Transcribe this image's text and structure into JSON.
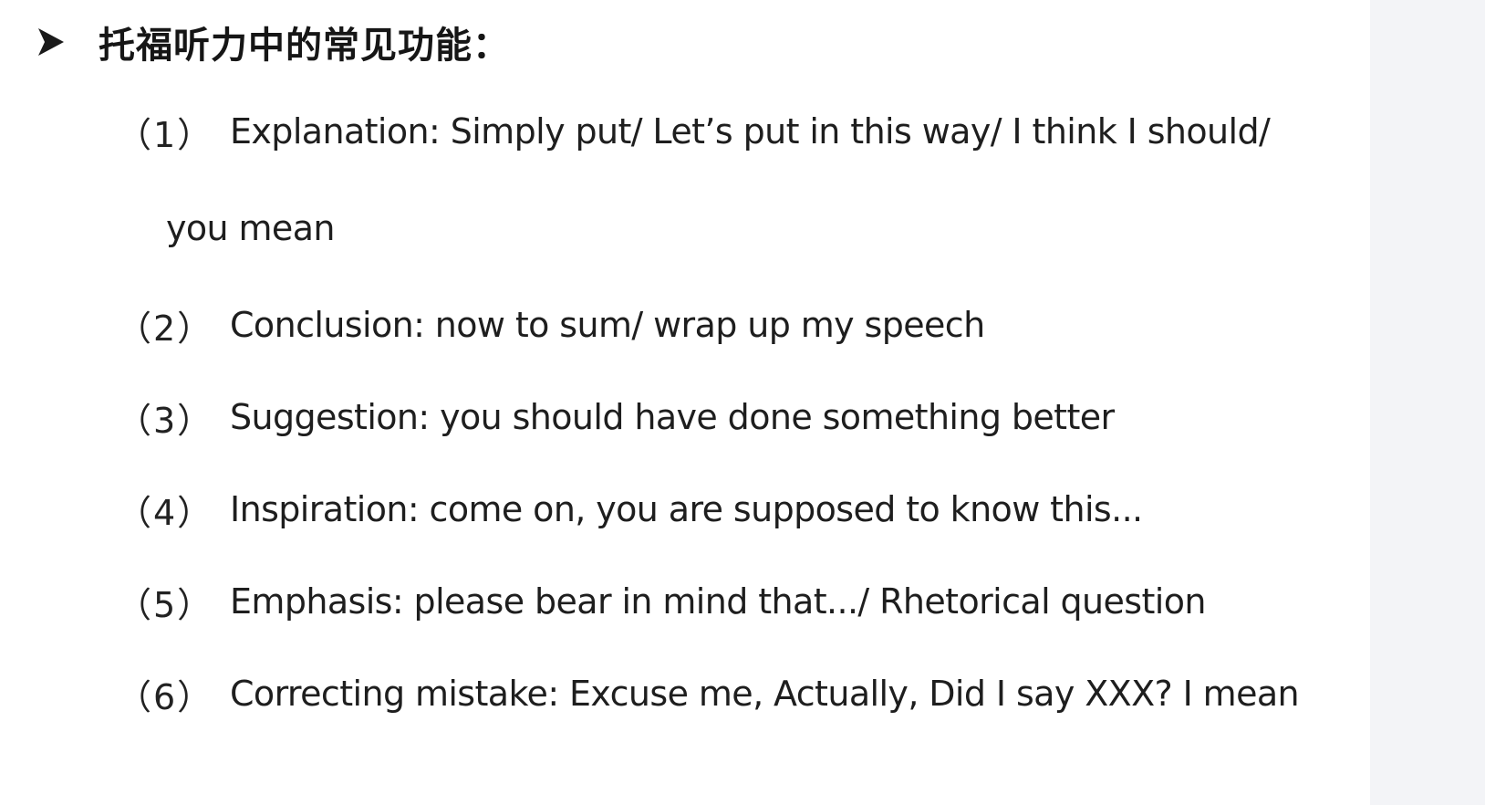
{
  "heading": {
    "bullet_icon": "arrowhead-bullet-icon",
    "text": "托福听力中的常见功能："
  },
  "items": [
    {
      "number": "（1）",
      "text": "Explanation: Simply put/ Let’s put in this way/ I think I should/",
      "continuation": "you mean"
    },
    {
      "number": "（2）",
      "text": "Conclusion: now to sum/ wrap up my speech"
    },
    {
      "number": "（3）",
      "text": "Suggestion: you should have done something better"
    },
    {
      "number": "（4）",
      "text": "Inspiration: come on, you are supposed to know this..."
    },
    {
      "number": "（5）",
      "text": "Emphasis: please bear in mind that.../ Rhetorical question"
    },
    {
      "number": "（6）",
      "text": "Correcting mistake: Excuse me, Actually, Did I say XXX? I mean"
    }
  ],
  "colors": {
    "text": "#1e1e1e",
    "side_panel": "#f3f4f7",
    "background": "#ffffff"
  }
}
